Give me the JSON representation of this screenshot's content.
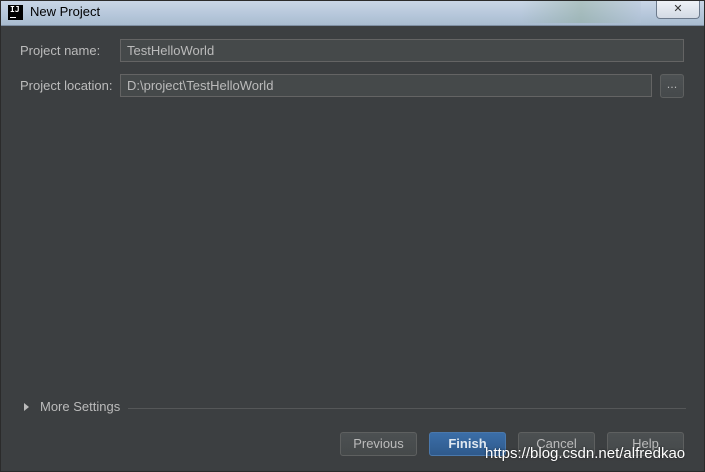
{
  "window": {
    "title": "New Project",
    "app_icon_text": "IJ",
    "close_glyph": "✕"
  },
  "form": {
    "project_name_label": "Project name:",
    "project_name_value": "TestHelloWorld",
    "project_location_label": "Project location:",
    "project_location_value": "D:\\project\\TestHelloWorld",
    "browse_label": "..."
  },
  "more_settings": {
    "label": "More Settings",
    "expanded": false
  },
  "buttons": {
    "previous": "Previous",
    "finish": "Finish",
    "cancel": "Cancel",
    "help": "Help"
  },
  "watermark": "https://blog.csdn.net/alfredkao",
  "colors": {
    "background": "#3c3f41",
    "field_background": "#45494a",
    "text": "#bbbbbb",
    "primary_button": "#365f92"
  }
}
